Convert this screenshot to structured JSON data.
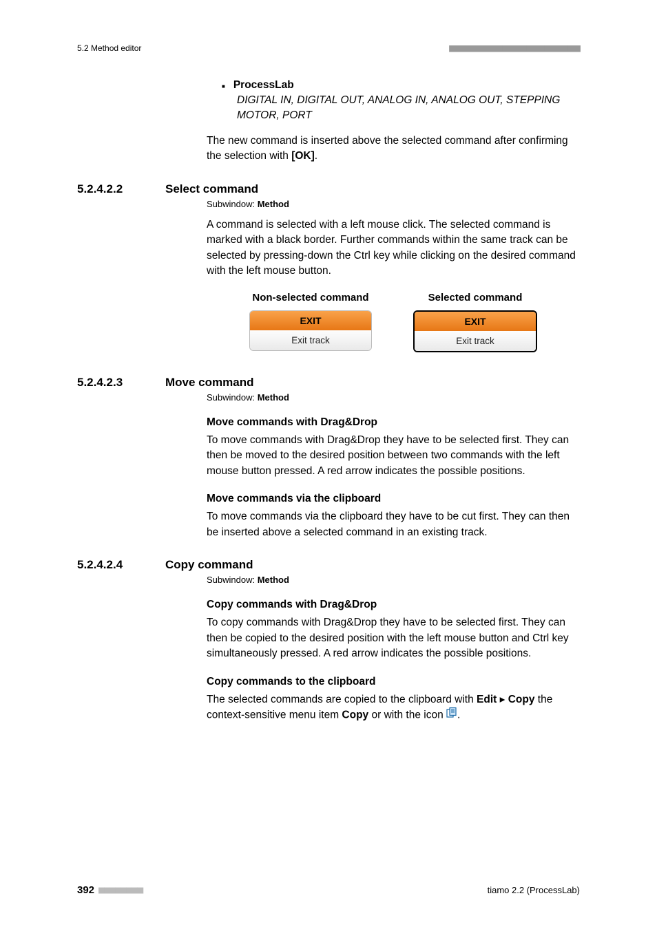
{
  "header": {
    "left": "5.2 Method editor",
    "right": "■■■■■■■■■■■■■■■■■■■■■■"
  },
  "bullet": {
    "title": "ProcessLab",
    "items": "DIGITAL IN, DIGITAL OUT, ANALOG IN, ANALOG OUT, STEPPING MOTOR, PORT"
  },
  "intro_para": {
    "p1_a": "The new command is inserted above the selected command after confirming the selection with ",
    "p1_ok": "[OK]",
    "p1_b": "."
  },
  "sec1": {
    "num": "5.2.4.2.2",
    "title": "Select command",
    "subwindow_label": "Subwindow: ",
    "subwindow_value": "Method",
    "para": "A command is selected with a left mouse click. The selected command is marked with a black border. Further commands within the same track can be selected by pressing-down the Ctrl key while clicking on the desired command with the left mouse button.",
    "compare": {
      "left_label": "Non-selected command",
      "right_label": "Selected command",
      "cmd_title": "EXIT",
      "cmd_sub": "Exit track"
    }
  },
  "sec2": {
    "num": "5.2.4.2.3",
    "title": "Move command",
    "subwindow_label": "Subwindow: ",
    "subwindow_value": "Method",
    "h1": "Move commands with Drag&Drop",
    "p1": "To move commands with Drag&Drop they have to be selected first. They can then be moved to the desired position between two commands with the left mouse button pressed. A red arrow indicates the possible positions.",
    "h2": "Move commands via the clipboard",
    "p2": "To move commands via the clipboard they have to be cut first. They can then be inserted above a selected command in an existing track."
  },
  "sec3": {
    "num": "5.2.4.2.4",
    "title": "Copy command",
    "subwindow_label": "Subwindow: ",
    "subwindow_value": "Method",
    "h1": "Copy commands with Drag&Drop",
    "p1": "To copy commands with Drag&Drop they have to be selected first. They can then be copied to the desired position with the left mouse button and Ctrl key simultaneously pressed. A red arrow indicates the possible positions.",
    "h2": "Copy commands to the clipboard",
    "p2_a": "The selected commands are copied to the clipboard with ",
    "p2_edit": "Edit",
    "p2_sep": " ▸ ",
    "p2_copy": "Copy",
    "p2_b": " the context-sensitive menu item ",
    "p2_copy2": "Copy",
    "p2_c": " or with the icon ",
    "p2_d": "."
  },
  "footer": {
    "page": "392",
    "dashes": "■■■■■■■■",
    "right": "tiamo 2.2 (ProcessLab)"
  }
}
